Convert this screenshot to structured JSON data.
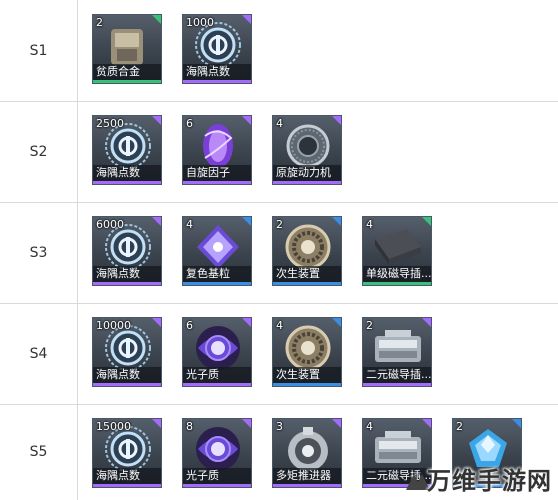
{
  "colors": {
    "rarity_green": "#39c07a",
    "rarity_purple": "#a56bff",
    "rarity_blue": "#3a8ee6",
    "row_border": "#d9d9d9"
  },
  "rows": [
    {
      "label": "S1",
      "items": [
        {
          "count": "2",
          "name": "贫质合金",
          "icon": "alloy-icon",
          "rarity": "green"
        },
        {
          "count": "1000",
          "name": "海隅点数",
          "icon": "coin-icon",
          "rarity": "purple"
        }
      ]
    },
    {
      "label": "S2",
      "items": [
        {
          "count": "2500",
          "name": "海隅点数",
          "icon": "coin-icon",
          "rarity": "purple"
        },
        {
          "count": "6",
          "name": "自旋因子",
          "icon": "spin-factor-icon",
          "rarity": "purple"
        },
        {
          "count": "4",
          "name": "原旋动力机",
          "icon": "power-engine-icon",
          "rarity": "purple"
        }
      ]
    },
    {
      "label": "S3",
      "items": [
        {
          "count": "6000",
          "name": "海隅点数",
          "icon": "coin-icon",
          "rarity": "purple"
        },
        {
          "count": "4",
          "name": "复色基粒",
          "icon": "crystal-icon",
          "rarity": "blue"
        },
        {
          "count": "2",
          "name": "次生装置",
          "icon": "ring-device-icon",
          "rarity": "blue"
        },
        {
          "count": "4",
          "name": "单级磁导插...",
          "icon": "plate-icon",
          "rarity": "green"
        }
      ]
    },
    {
      "label": "S4",
      "items": [
        {
          "count": "10000",
          "name": "海隅点数",
          "icon": "coin-icon",
          "rarity": "purple"
        },
        {
          "count": "6",
          "name": "光子质",
          "icon": "photon-icon",
          "rarity": "purple"
        },
        {
          "count": "4",
          "name": "次生装置",
          "icon": "ring-device-icon",
          "rarity": "blue"
        },
        {
          "count": "2",
          "name": "二元磁导插...",
          "icon": "module-icon",
          "rarity": "purple"
        }
      ]
    },
    {
      "label": "S5",
      "items": [
        {
          "count": "15000",
          "name": "海隅点数",
          "icon": "coin-icon",
          "rarity": "purple"
        },
        {
          "count": "8",
          "name": "光子质",
          "icon": "photon-icon",
          "rarity": "purple"
        },
        {
          "count": "3",
          "name": "多矩推进器",
          "icon": "thruster-icon",
          "rarity": "purple"
        },
        {
          "count": "4",
          "name": "二元磁导插...",
          "icon": "module-icon",
          "rarity": "purple"
        },
        {
          "count": "2",
          "name": "",
          "icon": "gem-icon",
          "rarity": "blue"
        }
      ]
    }
  ],
  "watermark": "万维手游网"
}
